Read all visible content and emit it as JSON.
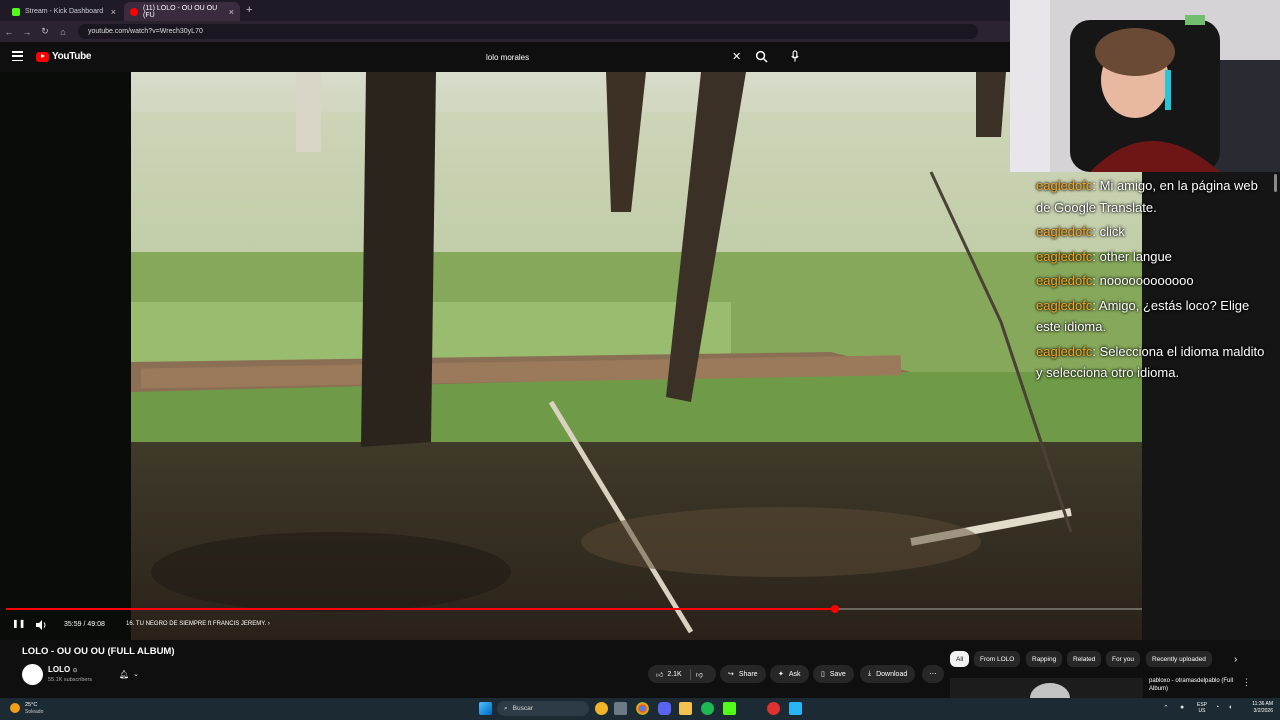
{
  "browser": {
    "tabs": [
      {
        "label": "Stream - Kick Dashboard",
        "color": "#53fc18"
      },
      {
        "label": "(11) LOLO - OU OU OU (FU",
        "color": "#ff0000"
      }
    ],
    "url": "youtube.com/watch?v=Wrech30yL70"
  },
  "youtube": {
    "logo": "YouTube",
    "search_value": "lolo morales"
  },
  "player": {
    "time": "35:59 / 49:08",
    "chapter": "16. TU NEGRO DE SIEMPRE ft FRANCIS JEREMY.",
    "progress": 0.73
  },
  "chat": [
    {
      "user": "eagledofc",
      "text": "Mi amigo, en la página web de Google Translate."
    },
    {
      "user": "eagledofc",
      "text": "click"
    },
    {
      "user": "eagledofc",
      "text": "other langue"
    },
    {
      "user": "eagledofc",
      "text": "noooooooooooo"
    },
    {
      "user": "eagledofc",
      "text": "Amigo, ¿estás loco? Elige este idioma."
    },
    {
      "user": "eagledofc",
      "text": "Selecciona el idioma maldito y selecciona otro idioma."
    }
  ],
  "video": {
    "title": "LOLO - OU OU OU (FULL ALBUM)",
    "channel": "LOLO",
    "verified": "⊙",
    "subscribers": "55.1K subscribers",
    "likes": "2.1K",
    "share": "Share",
    "ask": "Ask",
    "save": "Save",
    "download": "Download"
  },
  "chips": [
    "All",
    "From LOLO",
    "Rapping",
    "Related",
    "For you",
    "Recently uploaded"
  ],
  "recommendation": {
    "title": "pabloxo - otramasdelpablo (Full Album)"
  },
  "taskbar": {
    "temp": "25°C",
    "condition": "Soleado",
    "search": "Buscar",
    "lang_top": "ESP",
    "lang_bottom": "US",
    "time": "11:36 AM",
    "date": "3/2/2026"
  }
}
